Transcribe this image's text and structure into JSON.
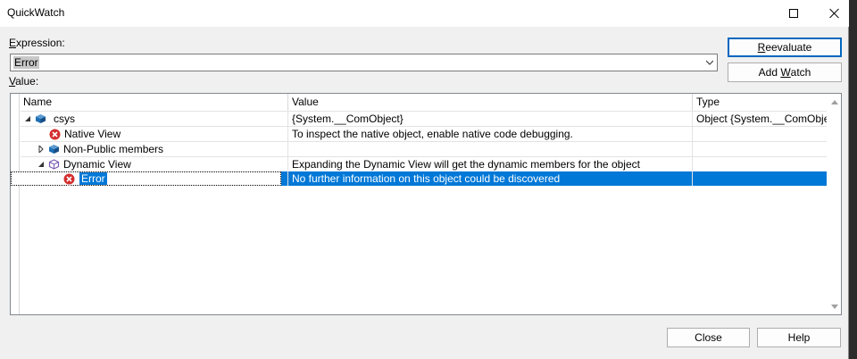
{
  "window": {
    "title": "QuickWatch"
  },
  "expression": {
    "label_prefix": "E",
    "label_rest": "xpression:",
    "value": "Error"
  },
  "value_section": {
    "label_prefix": "V",
    "label_rest": "alue:"
  },
  "buttons": {
    "reevaluate_prefix": "R",
    "reevaluate_rest": "eevaluate",
    "add_watch_prefix": "Add ",
    "add_watch_key": "W",
    "add_watch_rest": "atch",
    "close": "Close",
    "help": "Help"
  },
  "grid": {
    "columns": {
      "name": "Name",
      "value": "Value",
      "type": "Type"
    },
    "rows": [
      {
        "name": "csys",
        "value": "{System.__ComObject}",
        "type": "Object {System.__ComObje...",
        "icon": "object-icon",
        "expander": "expanded"
      },
      {
        "name": "Native View",
        "value": "To inspect the native object, enable native code debugging.",
        "type": "",
        "icon": "error-icon",
        "expander": "none"
      },
      {
        "name": "Non-Public members",
        "value": "",
        "type": "",
        "icon": "object-icon",
        "expander": "collapsed"
      },
      {
        "name": "Dynamic View",
        "value": "Expanding the Dynamic View will get the dynamic members for the object",
        "type": "",
        "icon": "dynamic-view-icon",
        "expander": "expanded"
      },
      {
        "name": "Error",
        "value": "No further information on this object could be discovered",
        "type": "",
        "icon": "error-icon",
        "expander": "none",
        "selected": true
      }
    ]
  },
  "colors": {
    "selection": "#0078d7",
    "error": "#d32f2f",
    "object": "#1f6fb5",
    "dynamic": "#7a5bb5",
    "accent_border": "#0067c0"
  }
}
